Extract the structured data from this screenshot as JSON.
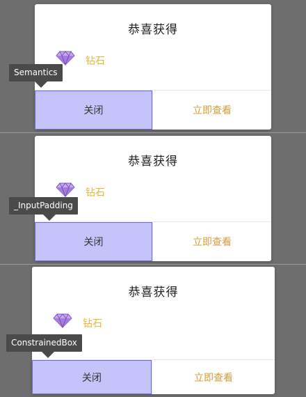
{
  "dialogs": [
    {
      "title": "恭喜获得",
      "reward_icon": "diamond-icon",
      "reward_label": "钻石",
      "close_label": "关闭",
      "view_label": "立即查看",
      "inspector_label": "Semantics"
    },
    {
      "title": "恭喜获得",
      "reward_icon": "diamond-icon",
      "reward_label": "钻石",
      "close_label": "关闭",
      "view_label": "立即查看",
      "inspector_label": "_InputPadding"
    },
    {
      "title": "恭喜获得",
      "reward_icon": "diamond-icon",
      "reward_label": "钻石",
      "close_label": "关闭",
      "view_label": "立即查看",
      "inspector_label": "ConstrainedBox"
    }
  ],
  "colors": {
    "close_highlight": "#c4c4fb",
    "reward_label": "#e8b637",
    "view_button_text": "#d99c3a",
    "tooltip_bg": "#4a4a4a"
  }
}
